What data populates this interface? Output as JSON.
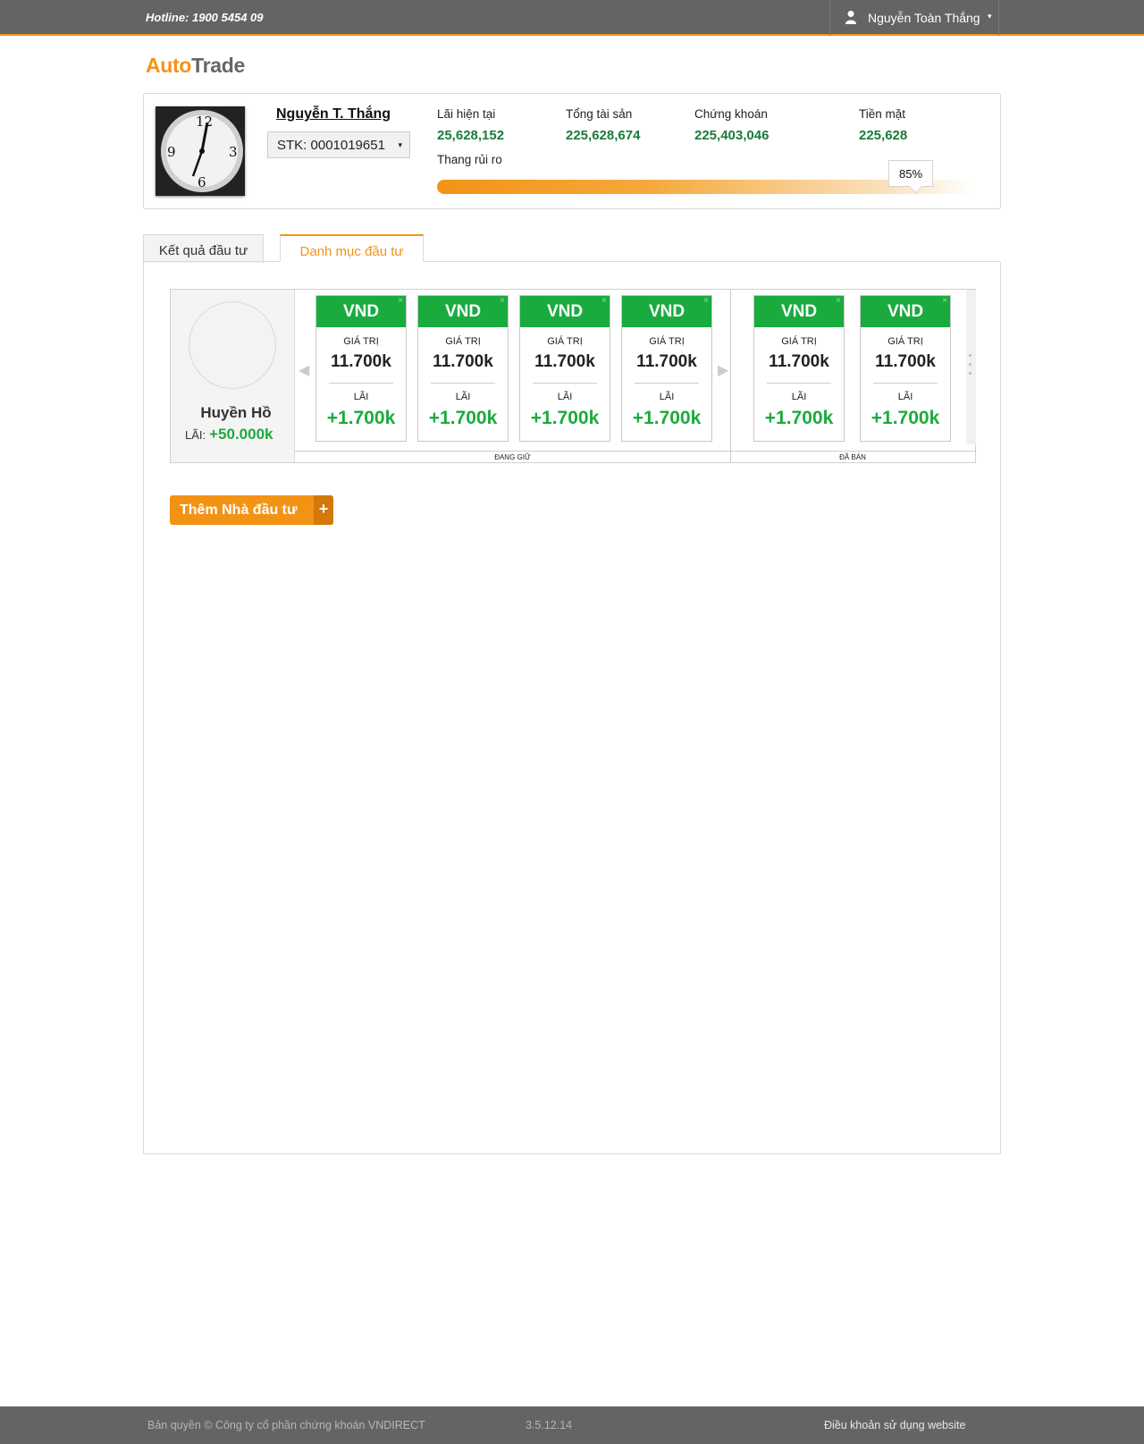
{
  "topbar": {
    "hotline": "Hotline: 1900 5454 09",
    "user_name": "Nguyễn Toàn Thắng",
    "user_icon": "user-icon",
    "caret": "▾"
  },
  "logo": {
    "part1": "Auto",
    "part2": "Trade"
  },
  "profile": {
    "name": "Nguyễn T. Thắng",
    "account": "STK: 0001019651",
    "account_caret": "▾",
    "stats": [
      {
        "label": "Lãi hiện tại",
        "value": "25,628,152"
      },
      {
        "label": "Tổng tài sản",
        "value": "225,628,674"
      },
      {
        "label": "Chứng khoán",
        "value": "225,403,046"
      },
      {
        "label": "Tiền mặt",
        "value": "225,628"
      }
    ],
    "risk_label": "Thang rủi ro",
    "risk_value": "85%",
    "risk_fraction": 0.85
  },
  "tabs": [
    {
      "label": "Kết quả đầu tư",
      "active": false
    },
    {
      "label": "Danh mục đầu tư",
      "active": true
    }
  ],
  "investor": {
    "name": "Huyền Hồ",
    "lai_label": "LÃI:",
    "lai_value": "+50.000k",
    "holding_label": "ĐANG GIỮ",
    "sold_label": "ĐÃ BÁN",
    "card_value_label": "GIÁ  TRỊ",
    "card_profit_label": "LÃI",
    "close_glyph": "×",
    "prev_glyph": "◀",
    "next_glyph": "▶",
    "holding": [
      {
        "ticker": "VND",
        "value": "11.700k",
        "profit": "+1.700k"
      },
      {
        "ticker": "VND",
        "value": "11.700k",
        "profit": "+1.700k"
      },
      {
        "ticker": "VND",
        "value": "11.700k",
        "profit": "+1.700k"
      },
      {
        "ticker": "VND",
        "value": "11.700k",
        "profit": "+1.700k"
      }
    ],
    "sold": [
      {
        "ticker": "VND",
        "value": "11.700k",
        "profit": "+1.700k"
      },
      {
        "ticker": "VND",
        "value": "11.700k",
        "profit": "+1.700k"
      }
    ]
  },
  "add_button": {
    "label": "Thêm Nhà đầu tư",
    "plus": "+"
  },
  "footer": {
    "copyright": "Bản quyền © Công ty cổ phần chứng khoán VNDIRECT",
    "version": "3.5.12.14",
    "terms": "Điều khoản sử dụng website"
  },
  "colors": {
    "accent": "#f39316",
    "green": "#1aab3f",
    "dark_green": "#1b7b3a",
    "topbar": "#646464"
  }
}
